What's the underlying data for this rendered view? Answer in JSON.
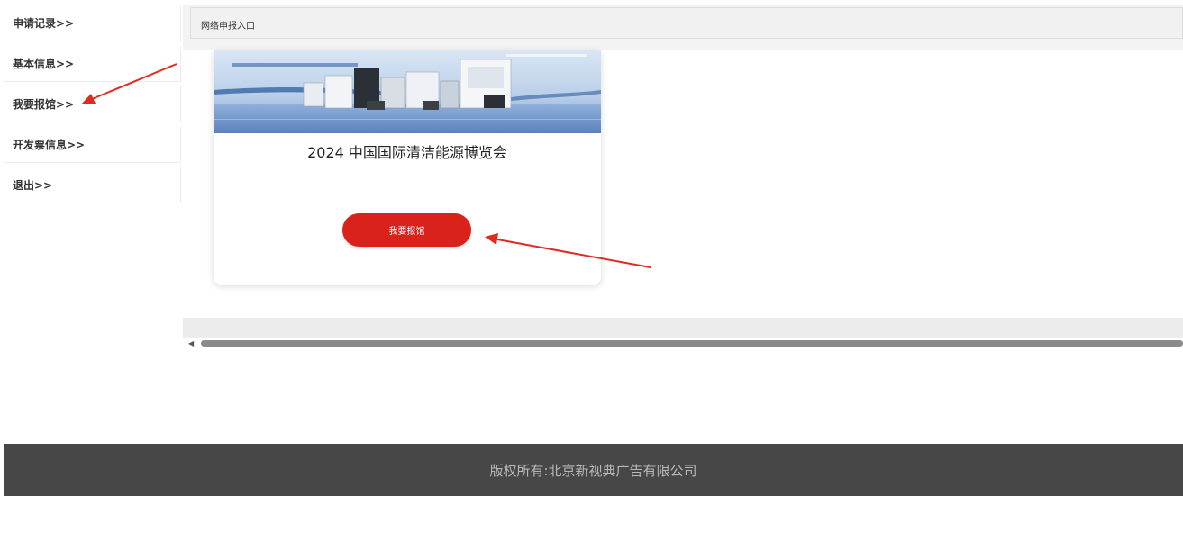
{
  "sidebar": {
    "items": [
      {
        "label": "申请记录>>"
      },
      {
        "label": "基本信息>>"
      },
      {
        "label": "我要报馆>>"
      },
      {
        "label": "开发票信息>>"
      },
      {
        "label": "退出>>"
      }
    ]
  },
  "tabbar": {
    "label": "网络申报入口"
  },
  "card": {
    "title": "2024 中国国际清洁能源博览会",
    "button_label": "我要报馆"
  },
  "footer": {
    "text": "版权所有:北京新视典广告有限公司"
  },
  "colors": {
    "accent_red": "#d8221a",
    "footer_bg": "#474747",
    "annotation_arrow": "#e02b20"
  },
  "icons": [
    "scroll-left-arrow-icon",
    "annotation-arrow-icon"
  ]
}
